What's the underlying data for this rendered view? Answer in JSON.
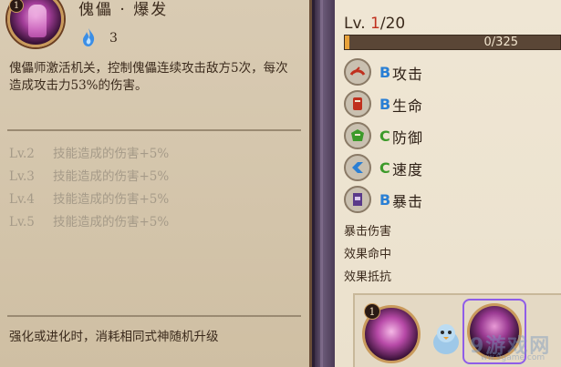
{
  "skill": {
    "portrait_badge": "1",
    "name": "傀儡 · 爆发",
    "cost": "3",
    "icon": "blue-fire-icon",
    "description": "傀儡师激活机关，控制傀儡连续攻击敌方5次，每次造成攻击力53%的伤害。",
    "levels": [
      {
        "lv": "Lv.2",
        "text": "技能造成的伤害+5%"
      },
      {
        "lv": "Lv.3",
        "text": "技能造成的伤害+5%"
      },
      {
        "lv": "Lv.4",
        "text": "技能造成的伤害+5%"
      },
      {
        "lv": "Lv.5",
        "text": "技能造成的伤害+5%"
      }
    ],
    "footer": "强化或进化时，消耗相同式神随机升级"
  },
  "stats_panel": {
    "level_prefix": "Lv. ",
    "level_current": "1",
    "level_max": "/20",
    "exp_text": "0/325",
    "exp_fraction": 0.02,
    "stats": [
      {
        "icon": "attack-icon",
        "grade": "B",
        "grade_color": "#2a7fd4",
        "label": "攻击"
      },
      {
        "icon": "health-icon",
        "grade": "B",
        "grade_color": "#2a7fd4",
        "label": "生命"
      },
      {
        "icon": "defense-icon",
        "grade": "C",
        "grade_color": "#3c9a2a",
        "label": "防御"
      },
      {
        "icon": "speed-icon",
        "grade": "C",
        "grade_color": "#3c9a2a",
        "label": "速度"
      },
      {
        "icon": "crit-icon",
        "grade": "B",
        "grade_color": "#2a7fd4",
        "label": "暴击"
      }
    ],
    "sub_stats": [
      "暴击伤害",
      "效果命中",
      "效果抵抗"
    ]
  },
  "tray": {
    "skill1_badge": "1",
    "watermark": "9游戏网",
    "watermark_sub": "ww.9game.com"
  }
}
